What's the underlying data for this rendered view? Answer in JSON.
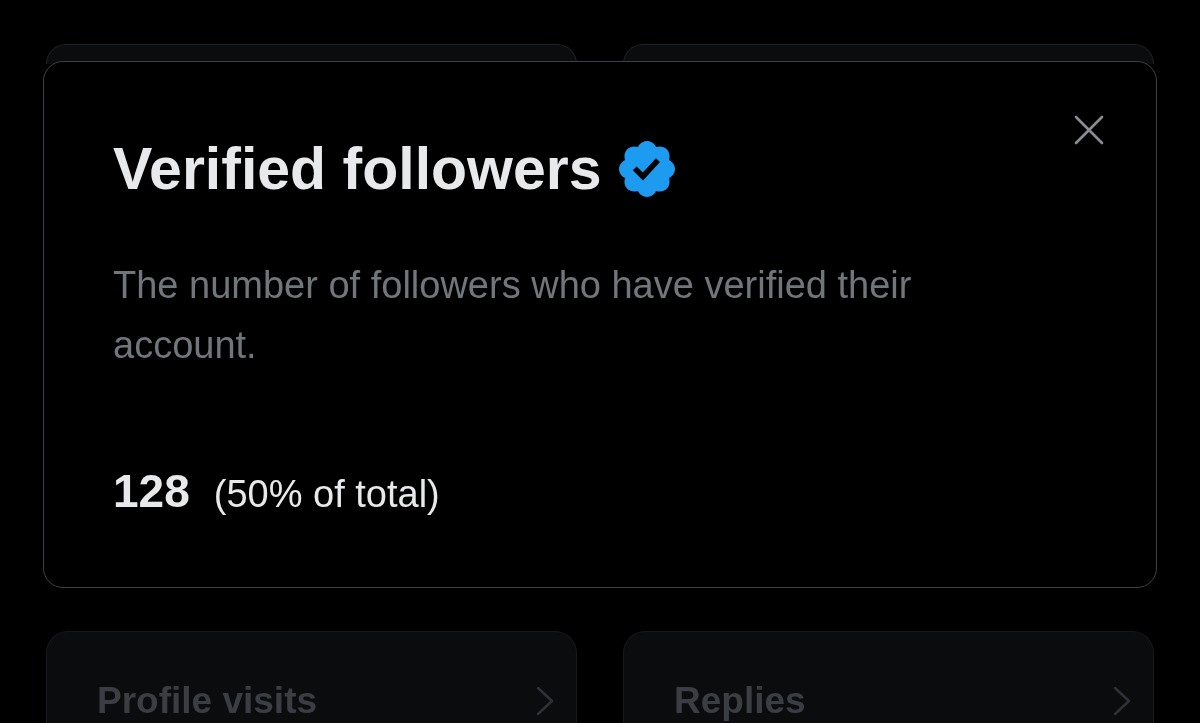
{
  "dialog": {
    "title": "Verified followers",
    "verified": true,
    "description": "The number of followers who have verified their account.",
    "count": "128",
    "share": "(50% of total)"
  },
  "cards": [
    {
      "title": "Profile visits"
    },
    {
      "title": "Replies"
    }
  ]
}
